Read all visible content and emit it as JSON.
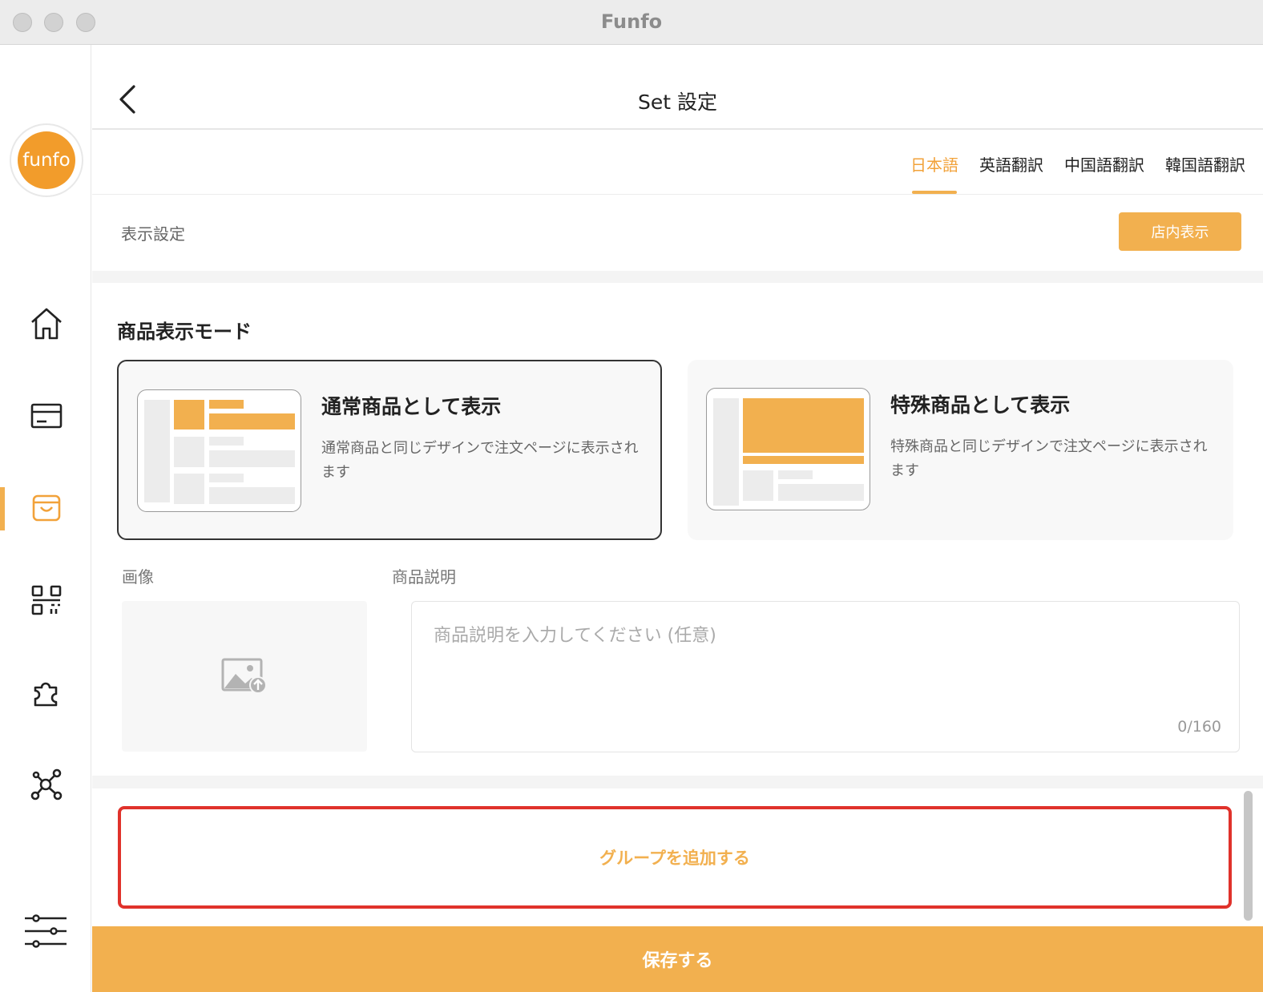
{
  "window": {
    "title": "Funfo"
  },
  "sidebar": {
    "logo_text": "funfo",
    "items": [
      {
        "name": "home",
        "icon": "home-icon"
      },
      {
        "name": "payment",
        "icon": "card-icon"
      },
      {
        "name": "products",
        "icon": "shopping-bag-icon",
        "active": true
      },
      {
        "name": "qr",
        "icon": "qr-code-icon"
      },
      {
        "name": "plugins",
        "icon": "puzzle-icon"
      },
      {
        "name": "network",
        "icon": "network-icon"
      },
      {
        "name": "settings",
        "icon": "sliders-icon"
      }
    ]
  },
  "header": {
    "title": "Set 設定"
  },
  "language_tabs": [
    {
      "label": "日本語",
      "active": true
    },
    {
      "label": "英語翻訳",
      "active": false
    },
    {
      "label": "中国語翻訳",
      "active": false
    },
    {
      "label": "韓国語翻訳",
      "active": false
    }
  ],
  "display_settings": {
    "label": "表示設定",
    "button_label": "店内表示"
  },
  "display_mode": {
    "title": "商品表示モード",
    "options": [
      {
        "title": "通常商品として表示",
        "description": "通常商品と同じデザインで注文ページに表示されます",
        "selected": true
      },
      {
        "title": "特殊商品として表示",
        "description": "特殊商品と同じデザインで注文ページに表示されます",
        "selected": false
      }
    ]
  },
  "fields": {
    "image_label": "画像",
    "description_label": "商品説明",
    "description_placeholder": "商品説明を入力してください (任意)",
    "description_counter": "0/160"
  },
  "actions": {
    "add_group_label": "グループを追加する",
    "save_label": "保存する"
  },
  "colors": {
    "accent": "#f2b04f",
    "highlight_border": "#e0322b"
  }
}
